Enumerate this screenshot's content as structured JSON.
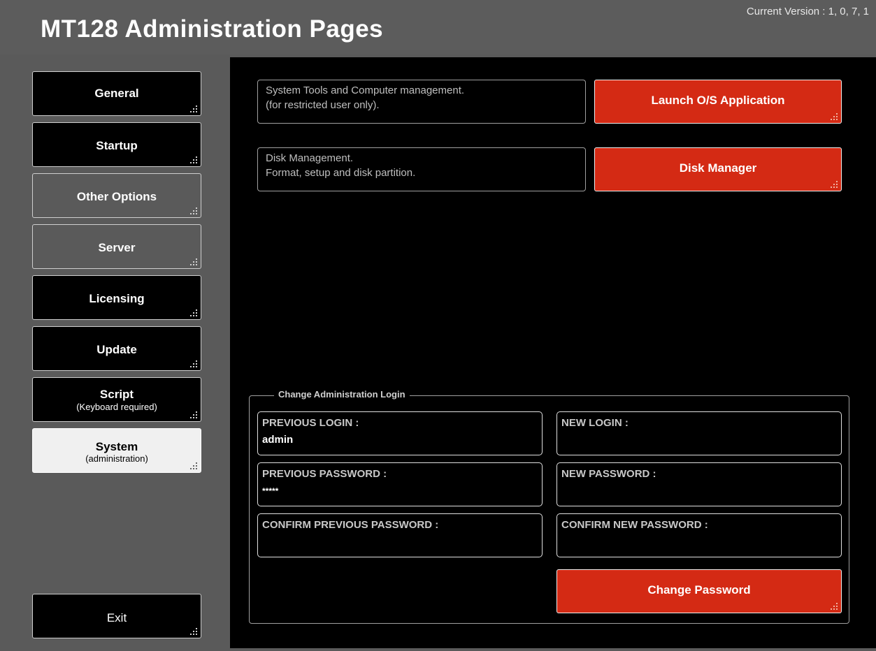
{
  "header": {
    "title": "MT128 Administration Pages",
    "version": "Current Version : 1, 0, 7, 1"
  },
  "sidebar": {
    "items": [
      {
        "label": "General"
      },
      {
        "label": "Startup"
      },
      {
        "label": "Other Options"
      },
      {
        "label": "Server"
      },
      {
        "label": "Licensing"
      },
      {
        "label": "Update"
      },
      {
        "label": "Script",
        "sublabel": "(Keyboard required)"
      },
      {
        "label": "System",
        "sublabel": "(administration)",
        "selected": true
      }
    ],
    "exit_label": "Exit"
  },
  "tools": {
    "os_description_line1": "System Tools and Computer management.",
    "os_description_line2": "(for restricted user only).",
    "os_button": "Launch O/S Application",
    "disk_description_line1": "Disk Management.",
    "disk_description_line2": "Format, setup and disk partition.",
    "disk_button": "Disk Manager"
  },
  "login_panel": {
    "legend": "Change Administration Login",
    "previous_login_label": "PREVIOUS LOGIN :",
    "previous_login_value": "admin",
    "new_login_label": "NEW LOGIN :",
    "new_login_value": "",
    "previous_password_label": "PREVIOUS PASSWORD :",
    "previous_password_value": "*****",
    "new_password_label": "NEW PASSWORD :",
    "new_password_value": "",
    "confirm_previous_password_label": "CONFIRM PREVIOUS PASSWORD :",
    "confirm_previous_password_value": "",
    "confirm_new_password_label": "CONFIRM NEW PASSWORD :",
    "confirm_new_password_value": "",
    "change_password_button": "Change Password"
  },
  "colors": {
    "accent_red": "#d42a14",
    "background_gray": "#5a5a5a",
    "panel_black": "#000000"
  }
}
